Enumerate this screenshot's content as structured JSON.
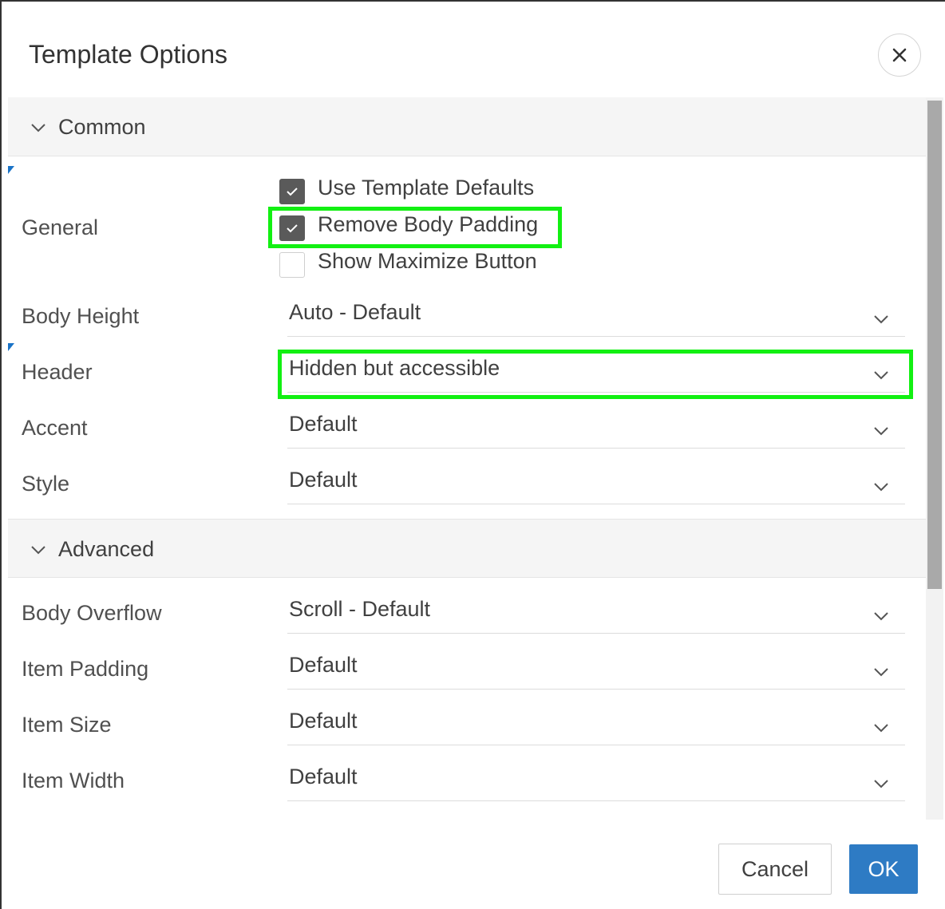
{
  "dialog": {
    "title": "Template Options",
    "close_icon": "close-icon"
  },
  "sections": {
    "common": {
      "label": "Common",
      "icon": "chevron-down-icon"
    },
    "advanced": {
      "label": "Advanced",
      "icon": "chevron-down-icon"
    }
  },
  "general": {
    "label": "General",
    "checkboxes": [
      {
        "label": "Use Template Defaults",
        "checked": true
      },
      {
        "label": "Remove Body Padding",
        "checked": true
      },
      {
        "label": "Show Maximize Button",
        "checked": false
      }
    ]
  },
  "fields": {
    "body_height": {
      "label": "Body Height",
      "value": "Auto - Default"
    },
    "header": {
      "label": "Header",
      "value": "Hidden but accessible"
    },
    "accent": {
      "label": "Accent",
      "value": "Default"
    },
    "style": {
      "label": "Style",
      "value": "Default"
    },
    "body_overflow": {
      "label": "Body Overflow",
      "value": "Scroll - Default"
    },
    "item_padding": {
      "label": "Item Padding",
      "value": "Default"
    },
    "item_size": {
      "label": "Item Size",
      "value": "Default"
    },
    "item_width": {
      "label": "Item Width",
      "value": "Default"
    }
  },
  "footer": {
    "cancel_label": "Cancel",
    "ok_label": "OK"
  },
  "colors": {
    "primary": "#2e7bc4",
    "highlight": "#12f012",
    "checkbox_checked": "#5a5a5a"
  }
}
